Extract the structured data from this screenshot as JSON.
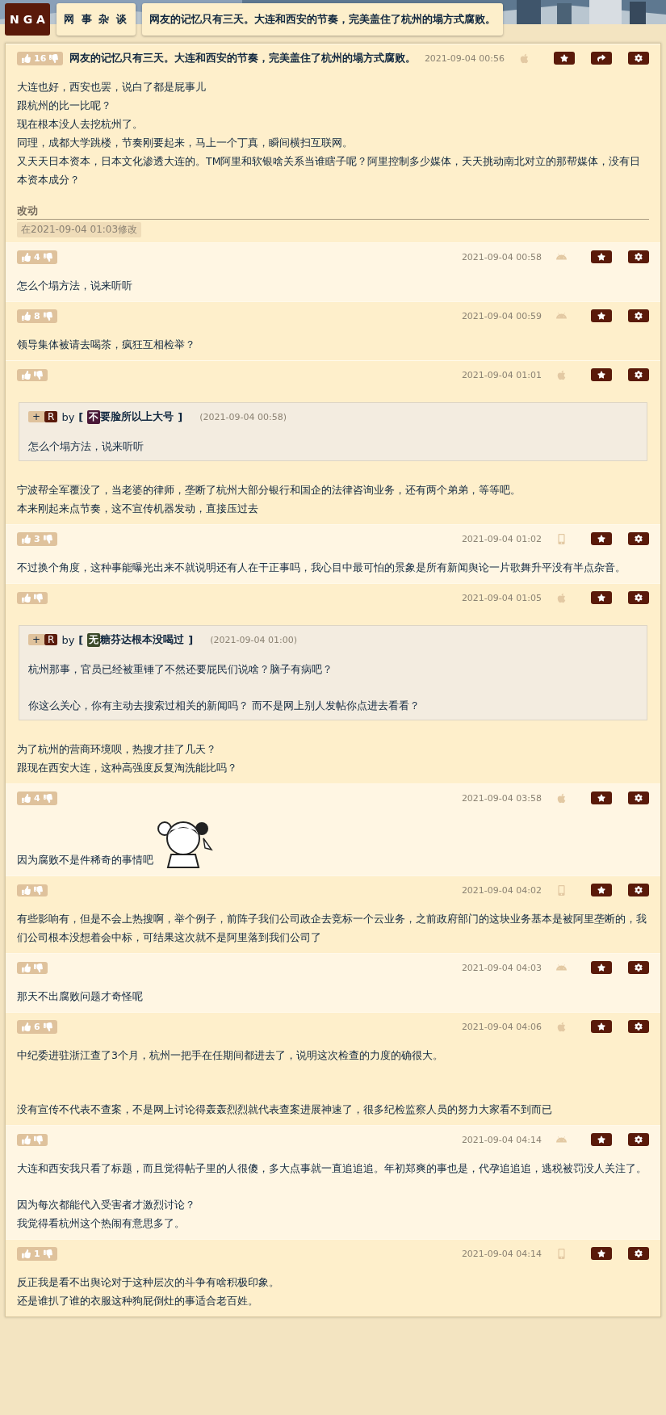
{
  "header": {
    "logo": "N G A",
    "forum": "网 事 杂 谈",
    "title": "网友的记忆只有三天。大连和西安的节奏，完美盖住了杭州的塌方式腐败。"
  },
  "posts": [
    {
      "highlighted": true,
      "votes": "16",
      "title": "网友的记忆只有三天。大连和西安的节奏，完美盖住了杭州的塌方式腐败。",
      "time": "2021-09-04 00:56",
      "device": {
        "kind": "apple"
      },
      "share": true,
      "blocks": [
        [
          "大连也好，西安也罢，说白了都是屁事儿",
          "跟杭州的比一比呢？",
          "现在根本没人去挖杭州了。",
          "同理，成都大学跳楼，节奏刚要起来，马上一个丁真，瞬间横扫互联网。",
          "又天天日本资本，日本文化渗透大连的。TM阿里和软银啥关系当谁瞎子呢？阿里控制多少媒体，天天挑动南北对立的那帮媒体，没有日本资本成分？"
        ]
      ],
      "edit": {
        "heading": "改动",
        "note": "在2021-09-04 01:03修改"
      }
    },
    {
      "highlighted": false,
      "votes": "4",
      "time": "2021-09-04 00:58",
      "device": {
        "kind": "android"
      },
      "share": false,
      "blocks": [
        [
          "怎么个塌方法，说来听听"
        ]
      ]
    },
    {
      "highlighted": true,
      "votes": "8",
      "time": "2021-09-04 00:59",
      "device": {
        "kind": "android"
      },
      "share": false,
      "blocks": [
        [
          "领导集体被请去喝茶，疯狂互相检举？"
        ]
      ]
    },
    {
      "highlighted": true,
      "time": "2021-09-04 01:01",
      "device": {
        "kind": "apple"
      },
      "share": false,
      "quote": {
        "plus": "+",
        "badge": "R",
        "by": "by",
        "open": "[",
        "initial": "不",
        "color": "#4a1838",
        "name": "要脸所以上大号",
        "close": "]",
        "time": "(2021-09-04 00:58)",
        "blocks": [
          [
            "怎么个塌方法，说来听听"
          ]
        ]
      },
      "blocks": [
        [
          "宁波帮全军覆没了，当老婆的律师，垄断了杭州大部分银行和国企的法律咨询业务，还有两个弟弟，等等吧。",
          "本来刚起来点节奏，这不宣传机器发动，直接压过去"
        ]
      ]
    },
    {
      "highlighted": false,
      "votes": "3",
      "time": "2021-09-04 01:02",
      "device": {
        "kind": "phone"
      },
      "share": false,
      "blocks": [
        [
          "不过换个角度，这种事能曝光出来不就说明还有人在干正事吗，我心目中最可怕的景象是所有新闻舆论一片歌舞升平没有半点杂音。"
        ]
      ]
    },
    {
      "highlighted": true,
      "time": "2021-09-04 01:05",
      "device": {
        "kind": "apple"
      },
      "share": false,
      "quote": {
        "plus": "+",
        "badge": "R",
        "by": "by",
        "open": "[",
        "initial": "无",
        "color": "#3c4a2a",
        "name": "糖芬达根本没喝过",
        "close": "]",
        "time": "(2021-09-04 01:00)",
        "blocks": [
          [
            "杭州那事，官员已经被重锤了不然还要屁民们说啥？脑子有病吧？"
          ],
          [
            "你这么关心，你有主动去搜索过相关的新闻吗？ 而不是网上别人发帖你点进去看看？"
          ]
        ]
      },
      "blocks": [
        [
          "为了杭州的营商环境呗，热搜才挂了几天？",
          "跟现在西安大连，这种高强度反复淘洗能比吗？"
        ]
      ]
    },
    {
      "highlighted": false,
      "votes": "4",
      "time": "2021-09-04 03:58",
      "device": {
        "kind": "apple"
      },
      "share": false,
      "sticker": {
        "kind": "picture"
      },
      "blocks": [
        [
          "因为腐败不是件稀奇的事情吧"
        ]
      ]
    },
    {
      "highlighted": true,
      "time": "2021-09-04 04:02",
      "device": {
        "kind": "phone"
      },
      "share": false,
      "blocks": [
        [
          "有些影响有，但是不会上热搜啊，举个例子，前阵子我们公司政企去竞标一个云业务，之前政府部门的这块业务基本是被阿里垄断的，我们公司根本没想着会中标，可结果这次就不是阿里落到我们公司了"
        ]
      ]
    },
    {
      "highlighted": false,
      "time": "2021-09-04 04:03",
      "device": {
        "kind": "android"
      },
      "share": false,
      "blocks": [
        [
          "那天不出腐败问题才奇怪呢"
        ]
      ]
    },
    {
      "highlighted": true,
      "votes": "6",
      "time": "2021-09-04 04:06",
      "device": {
        "kind": "apple"
      },
      "share": false,
      "blocks": [
        [
          "中纪委进驻浙江查了3个月，杭州一把手在任期间都进去了，说明这次检查的力度的确很大。"
        ],
        [
          "没有宣传不代表不查案，不是网上讨论得轰轰烈烈就代表查案进展神速了，很多纪检监察人员的努力大家看不到而已"
        ]
      ],
      "wide_gap": true
    },
    {
      "highlighted": false,
      "time": "2021-09-04 04:14",
      "device": {
        "kind": "android"
      },
      "share": false,
      "blocks": [
        [
          "大连和西安我只看了标题，而且觉得帖子里的人很傻，多大点事就一直追追追。年初郑爽的事也是，代孕追追追，逃税被罚没人关注了。"
        ],
        [
          "因为每次都能代入受害者才激烈讨论？",
          "我觉得看杭州这个热闹有意思多了。"
        ]
      ]
    },
    {
      "highlighted": true,
      "votes": "1",
      "time": "2021-09-04 04:14",
      "device": {
        "kind": "phone"
      },
      "share": false,
      "blocks": [
        [
          "反正我是看不出舆论对于这种层次的斗争有啥积极印象。",
          "还是谁扒了谁的衣服这种狗屁倒灶的事适合老百姓。"
        ]
      ]
    }
  ]
}
